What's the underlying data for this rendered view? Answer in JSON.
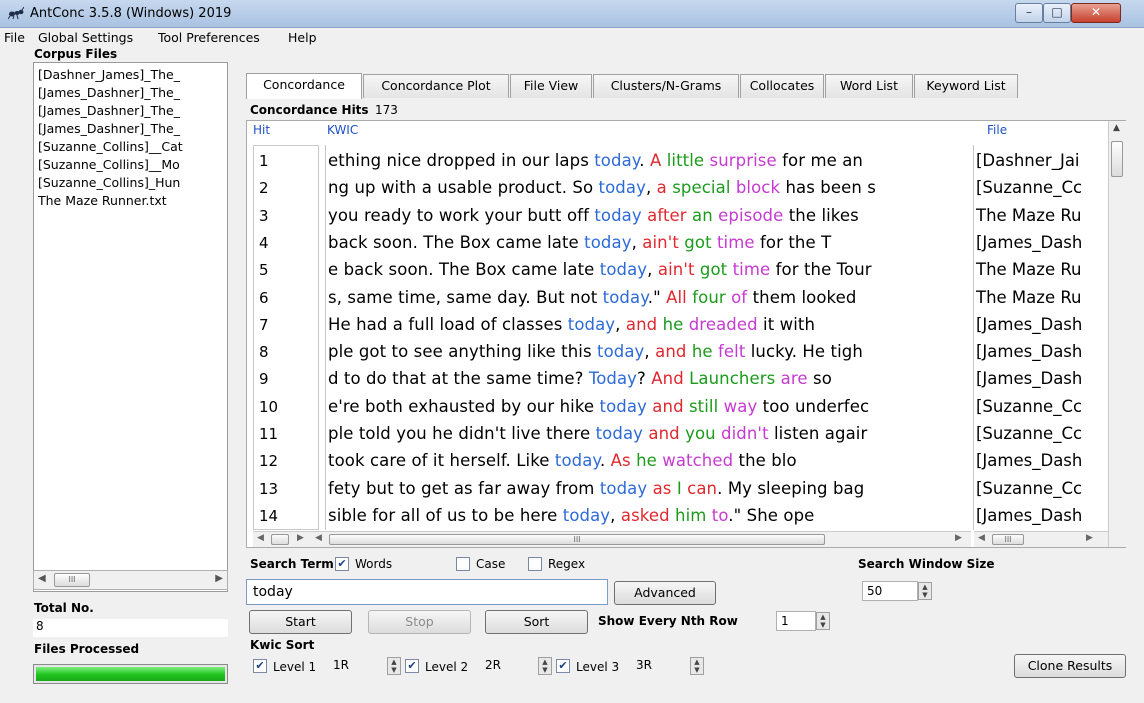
{
  "window": {
    "title": "AntConc 3.5.8 (Windows) 2019",
    "controls": {
      "minimize": "–",
      "maximize": "□",
      "close": "✕"
    }
  },
  "menu": [
    "File",
    "Global Settings",
    "Tool Preferences",
    "Help"
  ],
  "left_panel": {
    "corpus_label": "Corpus Files",
    "files": [
      "[Dashner_James]_The_",
      "[James_Dashner]_The_",
      "[James_Dashner]_The_",
      "[James_Dashner]_The_",
      "[Suzanne_Collins]__Cat",
      "[Suzanne_Collins]__Mo",
      "[Suzanne_Collins]_Hun",
      "The Maze Runner.txt"
    ],
    "total_label": "Total No.",
    "total_value": "8",
    "files_processed_label": "Files Processed",
    "progress": 1.0
  },
  "tabs": [
    "Concordance",
    "Concordance Plot",
    "File View",
    "Clusters/N-Grams",
    "Collocates",
    "Word List",
    "Keyword List"
  ],
  "active_tab": "Concordance",
  "hits": {
    "label": "Concordance Hits",
    "count": "173"
  },
  "columns": {
    "hit": "Hit",
    "kwic": "KWIC",
    "file": "File"
  },
  "rows": [
    {
      "n": "1",
      "left": "ething nice dropped in our laps ",
      "kw": "today",
      "right": [
        [
          ". ",
          ""
        ],
        [
          "A ",
          "red"
        ],
        [
          "little ",
          "green"
        ],
        [
          "surprise ",
          "pink"
        ],
        [
          "for me an",
          ""
        ]
      ],
      "file": "[Dashner_Jai"
    },
    {
      "n": "2",
      "left": "ng up with a usable product. So ",
      "kw": "today",
      "right": [
        [
          ", ",
          ""
        ],
        [
          "a ",
          "red"
        ],
        [
          "special ",
          "green"
        ],
        [
          "block ",
          "pink"
        ],
        [
          "has been s",
          ""
        ]
      ],
      "file": "[Suzanne_Cc"
    },
    {
      "n": "3",
      "left": "you ready to work your butt off ",
      "kw": "today",
      "right": [
        [
          " ",
          ""
        ],
        [
          "after ",
          "red"
        ],
        [
          "an ",
          "green"
        ],
        [
          "episode ",
          "pink"
        ],
        [
          "the likes ",
          ""
        ]
      ],
      "file": "The Maze Ru"
    },
    {
      "n": "4",
      "left": "back soon. The Box came late ",
      "kw": "today",
      "right": [
        [
          ", ",
          ""
        ],
        [
          "ain't ",
          "red"
        ],
        [
          "got ",
          "green"
        ],
        [
          "time ",
          "pink"
        ],
        [
          "for the T",
          ""
        ]
      ],
      "file": "[James_Dash"
    },
    {
      "n": "5",
      "left": "e back soon. The Box came late ",
      "kw": "today",
      "right": [
        [
          ", ",
          ""
        ],
        [
          "ain't ",
          "red"
        ],
        [
          "got ",
          "green"
        ],
        [
          "time ",
          "pink"
        ],
        [
          "for the Tour",
          ""
        ]
      ],
      "file": "The Maze Ru"
    },
    {
      "n": "6",
      "left": "s, same time, same day. But not ",
      "kw": "today",
      "right": [
        [
          ".\" ",
          ""
        ],
        [
          "All ",
          "red"
        ],
        [
          "four ",
          "green"
        ],
        [
          "of ",
          "pink"
        ],
        [
          "them looked",
          ""
        ]
      ],
      "file": "The Maze Ru"
    },
    {
      "n": "7",
      "left": "He had a full load of classes ",
      "kw": "today",
      "right": [
        [
          ", ",
          ""
        ],
        [
          "and ",
          "red"
        ],
        [
          "he ",
          "green"
        ],
        [
          "dreaded ",
          "pink"
        ],
        [
          "it with",
          ""
        ]
      ],
      "file": "[James_Dash"
    },
    {
      "n": "8",
      "left": "ple got to see anything like this ",
      "kw": "today",
      "right": [
        [
          ", ",
          ""
        ],
        [
          "and ",
          "red"
        ],
        [
          "he ",
          "green"
        ],
        [
          "felt ",
          "pink"
        ],
        [
          "lucky.  He tigh",
          ""
        ]
      ],
      "file": "[James_Dash"
    },
    {
      "n": "9",
      "left": "d to do that at the same time? ",
      "kw": "Today",
      "right": [
        [
          "? ",
          ""
        ],
        [
          "And ",
          "red"
        ],
        [
          "Launchers ",
          "green"
        ],
        [
          "are ",
          "pink"
        ],
        [
          "so",
          ""
        ]
      ],
      "file": "[James_Dash"
    },
    {
      "n": "10",
      "left": "e're both exhausted by our hike ",
      "kw": "today",
      "right": [
        [
          " ",
          ""
        ],
        [
          "and ",
          "red"
        ],
        [
          "still ",
          "green"
        ],
        [
          "way ",
          "pink"
        ],
        [
          "too underfec",
          ""
        ]
      ],
      "file": "[Suzanne_Cc"
    },
    {
      "n": "11",
      "left": "ple told you he didn't live there ",
      "kw": "today",
      "right": [
        [
          " ",
          ""
        ],
        [
          "and ",
          "red"
        ],
        [
          "you ",
          "green"
        ],
        [
          "didn't ",
          "pink"
        ],
        [
          "listen agair",
          ""
        ]
      ],
      "file": "[Suzanne_Cc"
    },
    {
      "n": "12",
      "left": "took care of it herself. Like ",
      "kw": "today",
      "right": [
        [
          ". ",
          ""
        ],
        [
          "As ",
          "red"
        ],
        [
          "he ",
          "green"
        ],
        [
          "watched ",
          "pink"
        ],
        [
          "the blo",
          ""
        ]
      ],
      "file": "[James_Dash"
    },
    {
      "n": "13",
      "left": "fety but to get as far away from ",
      "kw": "today",
      "right": [
        [
          " ",
          ""
        ],
        [
          "as ",
          "red"
        ],
        [
          "I ",
          "green"
        ],
        [
          "can",
          "red"
        ],
        [
          ". My sleeping bag",
          ""
        ]
      ],
      "file": "[Suzanne_Cc"
    },
    {
      "n": "14",
      "left": "sible for all of us to be here ",
      "kw": "today",
      "right": [
        [
          ", ",
          ""
        ],
        [
          "asked ",
          "red"
        ],
        [
          "him ",
          "green"
        ],
        [
          "to",
          "pink"
        ],
        [
          ".\" She ope",
          ""
        ]
      ],
      "file": "[James_Dash"
    }
  ],
  "search": {
    "term_label": "Search Term",
    "words_label": "Words",
    "words_checked": true,
    "case_label": "Case",
    "case_checked": false,
    "regex_label": "Regex",
    "regex_checked": false,
    "value": "today",
    "advanced_label": "Advanced",
    "window_size_label": "Search Window Size",
    "window_size": "50"
  },
  "actions": {
    "start": "Start",
    "stop": "Stop",
    "sort": "Sort",
    "clone": "Clone Results"
  },
  "nth_row": {
    "label": "Show Every Nth Row",
    "value": "1"
  },
  "kwic_sort": {
    "label": "Kwic Sort",
    "levels": [
      {
        "label": "Level 1",
        "value": "1R"
      },
      {
        "label": "Level 2",
        "value": "2R"
      },
      {
        "label": "Level 3",
        "value": "3R"
      }
    ]
  },
  "scroll_thumb": "III",
  "colors": {
    "keyword": "#2d6ad8",
    "red": "#e0282f",
    "green": "#1b9b1b",
    "pink": "#c53ad0"
  }
}
